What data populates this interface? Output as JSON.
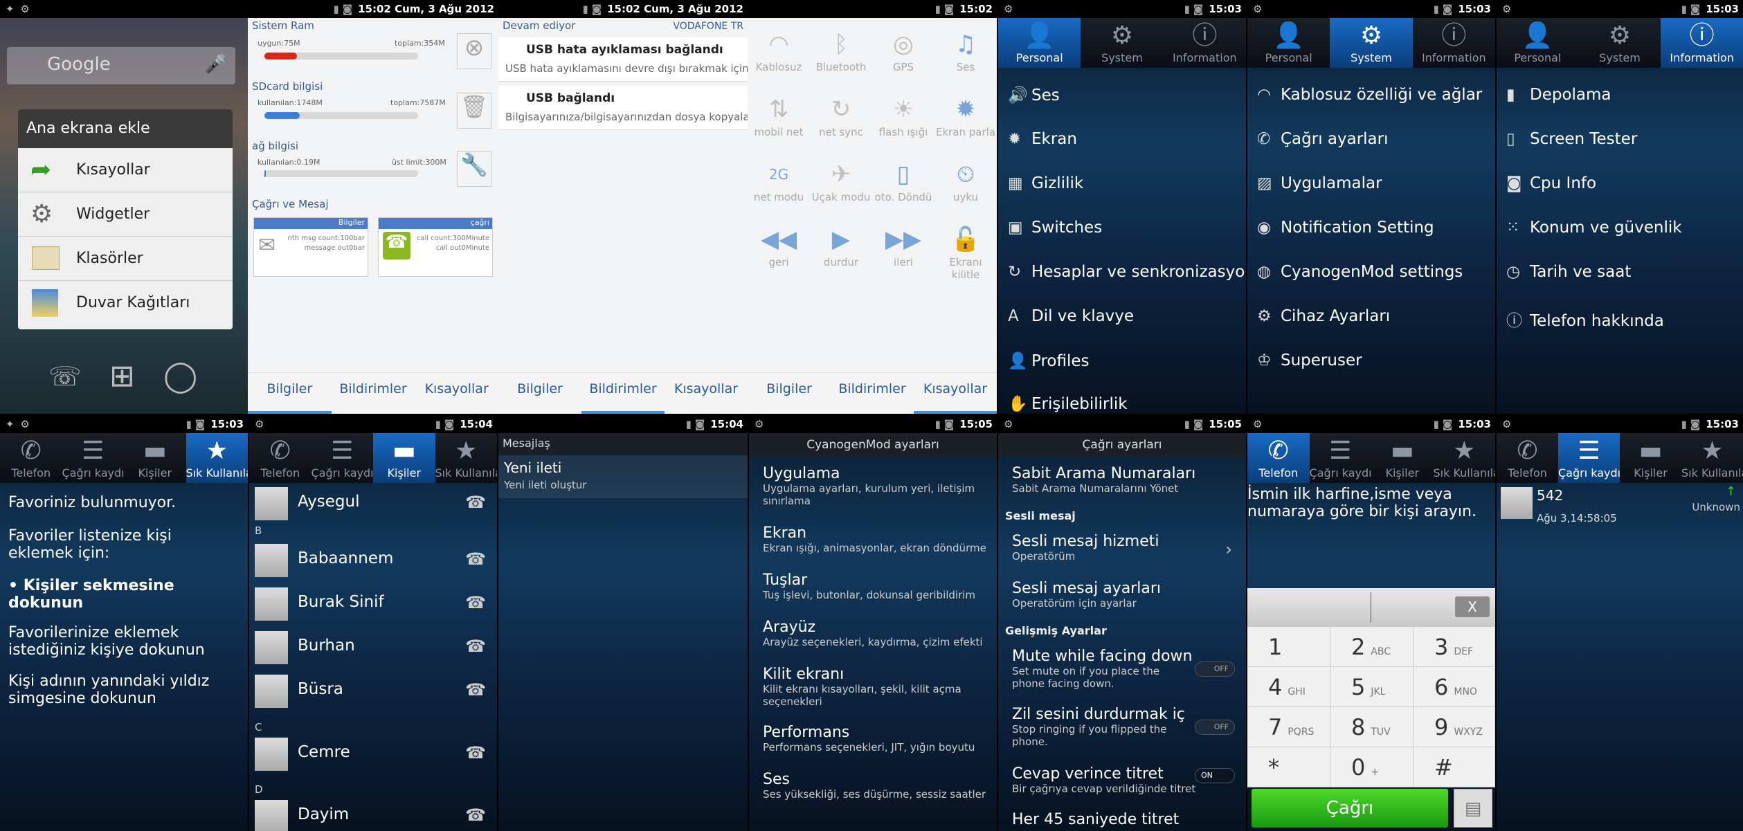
{
  "status": {
    "time1": "15:02",
    "date": "15:02 Cum, 3 Ağu 2012",
    "t1503": "15:03",
    "t1504": "15:04",
    "t1505": "15:05"
  },
  "launcher": {
    "search": "Google",
    "dialog_title": "Ana ekrana ekle",
    "items": [
      "Kısayollar",
      "Widgetler",
      "Klasörler",
      "Duvar Kağıtları"
    ]
  },
  "info": {
    "ram_title": "Sistem Ram",
    "ram_used": "uygun:75M",
    "ram_total": "toplam:354M",
    "ram_pct": 0.21,
    "sd_title": "SDcard bilgisi",
    "sd_used": "kullanılan:1748M",
    "sd_total": "toplam:7587M",
    "sd_pct": 0.23,
    "net_title": "ağ bilgisi",
    "net_used": "kullanılan:0.19M",
    "net_total": "üst limit:300M",
    "net_pct": 0.01,
    "call_title": "Çağrı ve Mesaj",
    "msg_card_title": "Bilgiler",
    "msg_card_1": "nth msg count:100bar",
    "msg_card_2": "message out0bar",
    "call_card_title": "çağrı",
    "call_card_1": "call count:300Minute",
    "call_card_2": "call out0Minute"
  },
  "bottom_tabs": [
    "Bilgiler",
    "Bildirimler",
    "Kısayollar"
  ],
  "notif": {
    "ongoing": "Devam ediyor",
    "carrier": "VODAFONE TR",
    "n1_title": "USB hata ayıklaması bağlandı",
    "n1_sub": "USB hata ayıklamasını devre dışı bırakmak için tık",
    "n2_title": "USB bağlandı",
    "n2_sub": "Bilgisayarınıza/bilgisayarınızdan dosya kopyalam"
  },
  "toggles": [
    "Kablosuz",
    "Bluetooth",
    "GPS",
    "Ses",
    "mobil net",
    "net sync",
    "flash ışığı",
    "Ekran parla",
    "net modu",
    "Uçak modu",
    "oto. Döndü",
    "uyku",
    "geri",
    "durdur",
    "ileri",
    "Ekranı kilitle"
  ],
  "settings_tabs": [
    "Personal",
    "System",
    "Information"
  ],
  "personal": [
    "Ses",
    "Ekran",
    "Gizlilik",
    "Switches",
    "Hesaplar ve senkronizasyon",
    "Dil ve klavye",
    "Profiles",
    "Erişilebilirlik"
  ],
  "system": [
    "Kablosuz özelliği ve ağlar",
    "Çağrı ayarları",
    "Uygulamalar",
    "Notification Setting",
    "CyanogenMod settings",
    "Cihaz Ayarları",
    "Superuser"
  ],
  "information": [
    "Depolama",
    "Screen Tester",
    "Cpu Info",
    "Konum ve güvenlik",
    "Tarih ve saat",
    "Telefon hakkında"
  ],
  "phone_tabs": [
    "Telefon",
    "Çağrı kaydı",
    "Kişiler",
    "Sık Kullanılanlar"
  ],
  "favorites": {
    "none": "Favoriniz bulunmuyor.",
    "add": "Favoriler listenize kişi eklemek için:",
    "step1": "Kişiler sekmesine dokunun",
    "step2": "Favorilerinize eklemek istediğiniz kişiye dokunun",
    "step3": "Kişi adının yanındaki yıldız simgesine dokunun"
  },
  "contacts": {
    "A": [
      "Aysegul"
    ],
    "B": [
      "Babaannem",
      "Burak Sinif",
      "Burhan",
      "Büsra"
    ],
    "C": [
      "Cemre"
    ],
    "D": [
      "Dayim"
    ]
  },
  "messaging": {
    "header": "Mesajlaş",
    "new": "Yeni ileti",
    "new_sub": "Yeni ileti oluştur"
  },
  "cm": {
    "header": "CyanogenMod ayarları",
    "items": [
      {
        "t": "Uygulama",
        "s": "Uygulama ayarları, kurulum yeri, iletişim sınırlama"
      },
      {
        "t": "Ekran",
        "s": "Ekran ışığı, animasyonlar, ekran döndürme"
      },
      {
        "t": "Tuşlar",
        "s": "Tuş işlevi, butonlar, dokunsal geribildirim"
      },
      {
        "t": "Arayüz",
        "s": "Arayüz seçenekleri, kaydırma, çizim efekti"
      },
      {
        "t": "Kilit ekranı",
        "s": "Kilit ekranı kısayolları, şekil, kilit açma seçenekleri"
      },
      {
        "t": "Performans",
        "s": "Performans seçenekleri, JIT, yığın boyutu"
      },
      {
        "t": "Ses",
        "s": "Ses yüksekliği, ses düşürme, sessiz saatler"
      }
    ]
  },
  "call_settings": {
    "header": "Çağrı ayarları",
    "fdn": "Sabit Arama Numaraları",
    "fdn_sub": "Sabit Arama Numaralarını Yönet",
    "vm_cat": "Sesli mesaj",
    "vm1": "Sesli mesaj hizmeti",
    "vm1_sub": "Operatörüm",
    "vm2": "Sesli mesaj ayarları",
    "vm2_sub": "Operatörüm için ayarlar",
    "adv_cat": "Gelişmiş Ayarlar",
    "mute": "Mute while facing down",
    "mute_sub": "Set mute on if you place the phone facing down.",
    "flip": "Zil sesini durdurmak için",
    "flip_sub": "Stop ringing if you flipped the phone.",
    "vib": "Cevap verince titret",
    "vib_sub": "Bir çağrıya cevap verildiğinde titret",
    "more": "Her 45 saniyede titret",
    "off": "OFF",
    "on": "ON"
  },
  "dialer": {
    "hint": "İsmin ilk harfine,isme veya numaraya göre bir kişi arayın.",
    "clear": "X",
    "keys": [
      [
        "1",
        ""
      ],
      [
        "2",
        "ABC"
      ],
      [
        "3",
        "DEF"
      ],
      [
        "4",
        "GHI"
      ],
      [
        "5",
        "JKL"
      ],
      [
        "6",
        "MNO"
      ],
      [
        "7",
        "PQRS"
      ],
      [
        "8",
        "TUV"
      ],
      [
        "9",
        "WXYZ"
      ],
      [
        "*",
        ""
      ],
      [
        "0",
        "+"
      ],
      [
        "#",
        ""
      ]
    ],
    "call": "Çağrı"
  },
  "calllog": {
    "number": "542",
    "date": "Ağu 3,14:58:05",
    "label": "Unknown"
  }
}
